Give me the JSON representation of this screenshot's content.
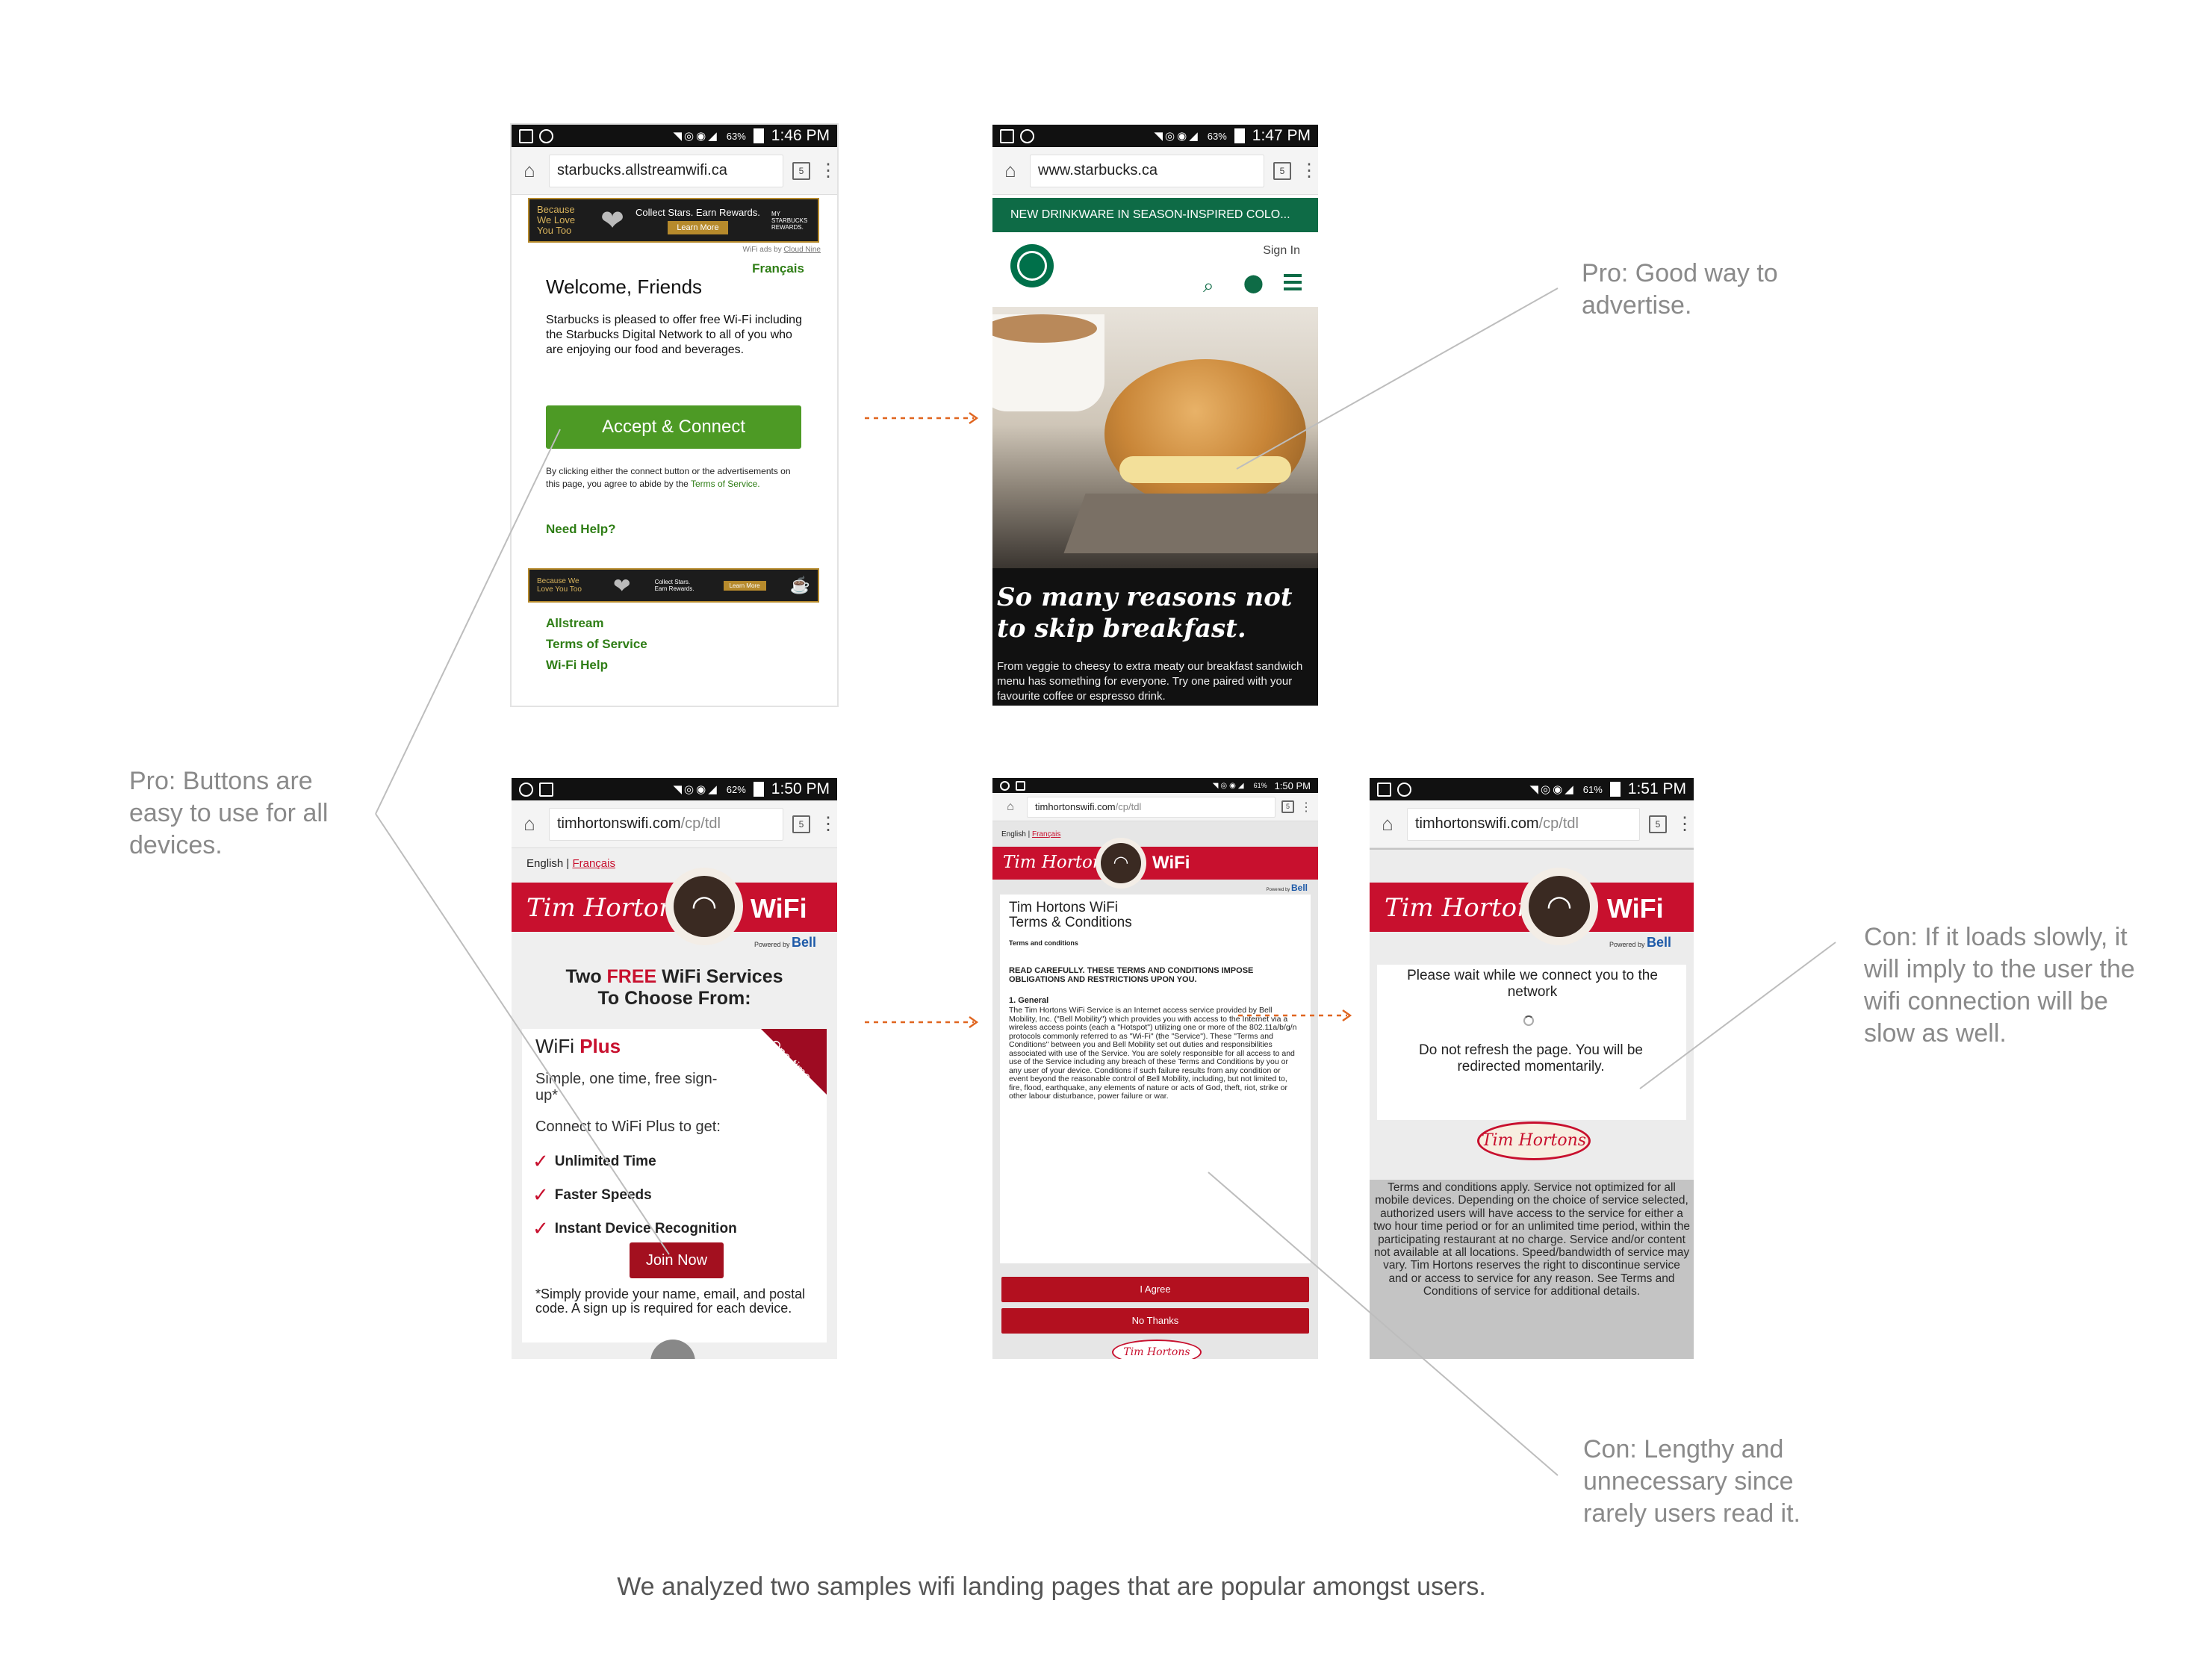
{
  "colors": {
    "starbucks_green": "#00704a",
    "connect_green": "#4d9a25",
    "tim_red": "#c8102e",
    "tim_dark": "#7a0a1c",
    "note_gray": "#8a8a8a",
    "arrow_orange": "#e0651f"
  },
  "screens": {
    "s1": {
      "status": {
        "time": "1:46 PM",
        "battery": "63%"
      },
      "url": "starbucks.allstreamwifi.ca",
      "tabs": "5",
      "banner": {
        "left": "Because We Love You Too",
        "middle": "Collect Stars. Earn Rewards.",
        "button": "Learn More",
        "right": "MY STARBUCKS REWARDS."
      },
      "ads_credit": "WiFi ads by",
      "ads_brand": "Cloud Nine",
      "francais": "Français",
      "welcome": "Welcome, Friends",
      "intro": "Starbucks is pleased to offer free Wi-Fi including the Starbucks Digital Network to all of you who are enjoying our food and beverages.",
      "connect": "Accept & Connect",
      "legal": "By clicking either the connect button or the advertisements on this page, you agree to abide by the",
      "legal_link": "Terms of Service.",
      "need_help": "Need Help?",
      "banner2": {
        "left": "Because We Love You Too",
        "middle": "Collect Stars. Earn Rewards.",
        "button": "Learn More"
      },
      "links": [
        "Allstream",
        "Terms of Service",
        "Wi-Fi Help"
      ]
    },
    "s2": {
      "status": {
        "time": "1:47 PM",
        "battery": "63%"
      },
      "url": "www.starbucks.ca",
      "tabs": "5",
      "promo": "NEW DRINKWARE IN SEASON-INSPIRED COLO...",
      "signin": "Sign In",
      "headline": "So many reasons not to skip breakfast.",
      "body": "From veggie to cheesy to extra meaty our breakfast sandwich menu has something for everyone. Try one paired with your favourite coffee or espresso drink."
    },
    "s3": {
      "status": {
        "time": "1:50 PM",
        "battery": "62%"
      },
      "url": "timhortonswifi.com",
      "url_path": "/cp/tdl",
      "tabs": "5",
      "lang_en": "English",
      "lang_sep": "|",
      "lang_fr": "Français",
      "brand": "Tim Hortons",
      "wifi": "WiFi",
      "powered": "Powered by",
      "bell": "Bell",
      "heading_1": "Two ",
      "heading_free": "FREE",
      "heading_2": " WiFi Services",
      "heading_3": "To Choose From:",
      "plan_a": "WiFi ",
      "plan_b": "Plus",
      "ribbon": "One-time Sign-up*",
      "sub": "Simple, one time, free sign-up*",
      "connect_to": "Connect to WiFi Plus to get:",
      "features": [
        "Unlimited Time",
        "Faster Speeds",
        "Instant Device Recognition"
      ],
      "join": "Join Now",
      "footnote": "*Simply provide your name, email, and postal code. A sign up is required for each device."
    },
    "s4": {
      "status": {
        "time": "1:50 PM",
        "battery": "61%"
      },
      "url": "timhortonswifi.com",
      "url_path": "/cp/tdl",
      "tabs": "5",
      "lang_en": "English",
      "lang_sep": "|",
      "lang_fr": "Français",
      "brand": "Tim Hortons",
      "wifi": "WiFi",
      "powered": "Powered by",
      "bell": "Bell",
      "title": "Tim Hortons WiFi Terms & Conditions",
      "sub": "Terms and conditions",
      "warning": "READ CAREFULLY. THESE TERMS AND CONDITIONS IMPOSE OBLIGATIONS AND RESTRICTIONS UPON YOU.",
      "section": "1. General",
      "body": "The Tim Hortons WiFi Service is an Internet access service provided by Bell Mobility, Inc. (\"Bell Mobility\") which provides you with access to the Internet via a wireless access points (each a \"Hotspot\") utilizing one or more of the 802.11a/b/g/n protocols commonly referred to as \"Wi-Fi\" (the \"Service\"). These \"Terms and Conditions\" between you and Bell Mobility set out duties and responsibilities associated with use of the Service. You are solely responsible for all access to and use of the Service including any breach of these Terms and Conditions by you or any user of your device. Conditions if such failure results from any condition or event beyond the reasonable control of Bell Mobility, including, but not limited to, fire, flood, earthquake, any elements of nature or acts of God, theft, riot, strike or other labour disturbance, power failure or war.",
      "agree": "I Agree",
      "no": "No Thanks",
      "logo": "Tim Hortons"
    },
    "s5": {
      "status": {
        "time": "1:51 PM",
        "battery": "61%"
      },
      "url": "timhortonswifi.com",
      "url_path": "/cp/tdl",
      "tabs": "5",
      "brand": "Tim Hortons",
      "wifi": "WiFi",
      "powered": "Powered by",
      "bell": "Bell",
      "wait": "Please wait while we connect you to the network",
      "refresh": "Do not refresh the page. You will be redirected momentarily.",
      "logo": "Tim Hortons",
      "terms": "Terms and conditions apply. Service not optimized for all mobile devices. Depending on the choice of service selected, authorized users will have access to the service for either a two hour time period or for an unlimited time period, within the participating restaurant at no charge. Service and/or content not available at all locations. Speed/bandwidth of service may vary. Tim Hortons reserves the right to discontinue service and or access to service for any reason. See Terms and Conditions of service for additional details."
    }
  },
  "notes": {
    "pro_advertise": "Pro: Good way to advertise.",
    "pro_buttons": "Pro: Buttons are easy to use for all devices.",
    "con_slow": "Con: If it loads slowly, it will imply to the user the wifi connection will be slow as well.",
    "con_lengthy": "Con: Lengthy and unnecessary since rarely users read it."
  },
  "caption": "We analyzed two samples wifi landing pages that are popular amongst users."
}
